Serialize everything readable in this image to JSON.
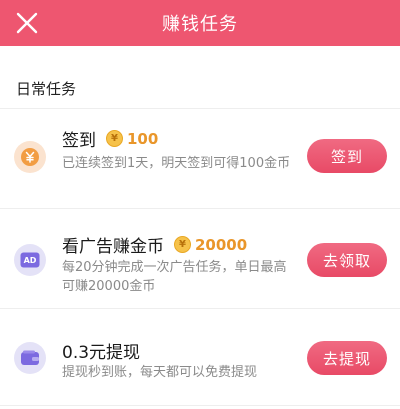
{
  "header": {
    "title": "赚钱任务",
    "bg_color": "#ee5670"
  },
  "section": {
    "title": "日常任务"
  },
  "tasks": [
    {
      "title": "签到",
      "reward": "100",
      "description": "已连续签到1天，明天签到可得100金币",
      "button": "签到",
      "icon": "yuan-coin-icon"
    },
    {
      "title": "看广告赚金币",
      "reward": "20000",
      "description": "每20分钟完成一次广告任务，单日最高可赚20000金币",
      "button": "去领取",
      "icon": "ad-icon"
    },
    {
      "title": "0.3元提现",
      "description": "提现秒到账，每天都可以免费提现",
      "button": "去提现",
      "icon": "wallet-icon"
    }
  ],
  "coin_symbol": "¥",
  "ad_label": "AD",
  "colors": {
    "accent": "#ee5670",
    "reward": "#e9962a",
    "coin": "#f6c24a"
  }
}
